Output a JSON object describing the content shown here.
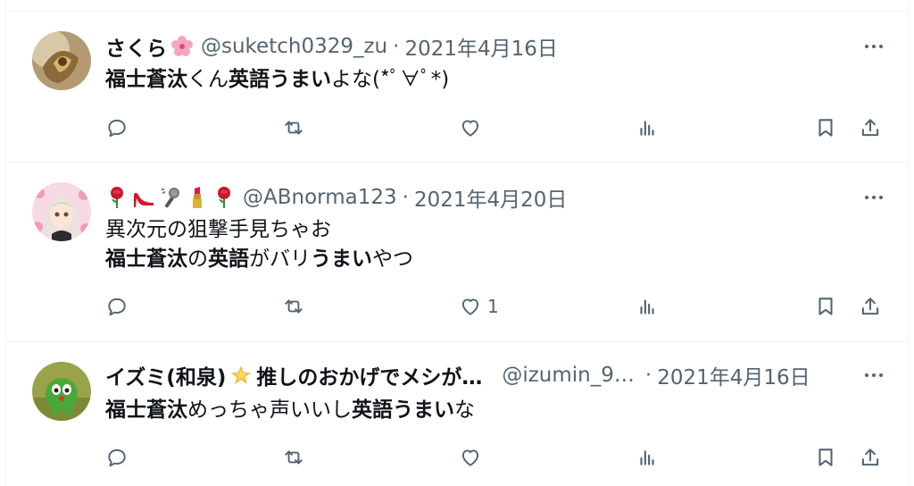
{
  "tweets": [
    {
      "display_name": "さくら",
      "emoji": "cherry-blossom",
      "handle": "@suketch0329_zu",
      "separator": "·",
      "date": "2021年4月16日",
      "lines": [
        [
          {
            "t": "福士蒼汰",
            "b": true
          },
          {
            "t": "くん",
            "b": false
          },
          {
            "t": "英語",
            "b": true
          },
          {
            "t": "うまい",
            "b": true
          },
          {
            "t": "よな(*ﾟ∀ﾟ*)",
            "b": false
          }
        ]
      ],
      "actions": {
        "reply": "",
        "retweet": "",
        "like": "",
        "views": ""
      }
    },
    {
      "display_name": "",
      "emoji_row": [
        "rose",
        "high-heel",
        "microphone",
        "lipstick",
        "rose"
      ],
      "handle": "@ABnorma123",
      "separator": "·",
      "date": "2021年4月20日",
      "lines": [
        [
          {
            "t": "異次元の狙撃手見ちゃお",
            "b": false
          }
        ],
        [
          {
            "t": "福士蒼汰",
            "b": true
          },
          {
            "t": "の",
            "b": false
          },
          {
            "t": "英語",
            "b": true
          },
          {
            "t": "がバリ",
            "b": false
          },
          {
            "t": "うまい",
            "b": true
          },
          {
            "t": "やつ",
            "b": false
          }
        ]
      ],
      "actions": {
        "reply": "",
        "retweet": "",
        "like": "1",
        "views": ""
      }
    },
    {
      "display_name": "イズミ(和泉)",
      "emoji": "glowing-star",
      "display_name_suffix": "推しのおかげでメシが…",
      "handle": "@izumin_9…",
      "separator": "·",
      "date": "2021年4月16日",
      "lines": [
        [
          {
            "t": "福士蒼汰",
            "b": true
          },
          {
            "t": "めっちゃ声いいし",
            "b": false
          },
          {
            "t": "英語",
            "b": true
          },
          {
            "t": "うまい",
            "b": true
          },
          {
            "t": "な",
            "b": false
          }
        ]
      ],
      "actions": {
        "reply": "",
        "retweet": "",
        "like": "",
        "views": ""
      }
    }
  ],
  "colors": {
    "muted": "#536471",
    "text": "#0f1419",
    "border": "#eff3f4"
  },
  "icons": [
    "reply-icon",
    "retweet-icon",
    "like-icon",
    "views-icon",
    "bookmark-icon",
    "share-icon",
    "more-icon"
  ]
}
